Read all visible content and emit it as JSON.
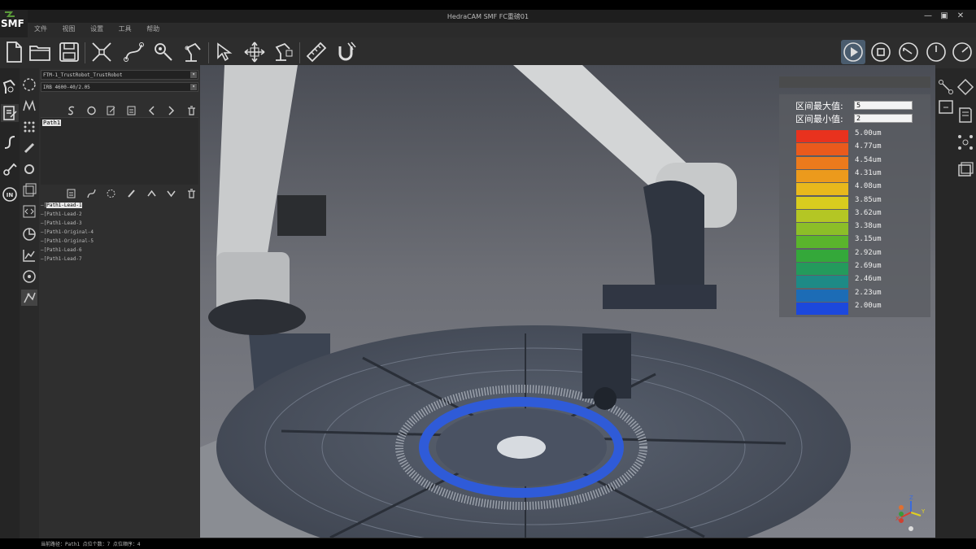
{
  "app": {
    "logo": "SMF",
    "title": "HedraCAM SMF FC重磅01",
    "window_controls": [
      "—",
      "▣",
      "✕"
    ]
  },
  "menu": [
    "文件",
    "视图",
    "设置",
    "工具",
    "帮助"
  ],
  "panel": {
    "robot_select": "FTM-1_TrustRobot_TrustRobot",
    "tool_select": "IRB 4600-40/2.05",
    "path_list": [
      "Path1"
    ],
    "tree_items": [
      {
        "label": "Path1-Lead-1",
        "selected": true
      },
      {
        "label": "Path1-Lead-2",
        "selected": false
      },
      {
        "label": "Path1-Lead-3",
        "selected": false
      },
      {
        "label": "Path1-Original-4",
        "selected": false
      },
      {
        "label": "Path1-Original-5",
        "selected": false
      },
      {
        "label": "Path1-Lead-6",
        "selected": false
      },
      {
        "label": "Path1-Lead-7",
        "selected": false
      }
    ]
  },
  "status": {
    "current_path": "当前路径：Path1  点位个数：7  点位顺序：4"
  },
  "legend": {
    "max_label": "区间最大值:",
    "max_value": "5",
    "min_label": "区间最小值:",
    "min_value": "2",
    "bands": [
      {
        "label": "5.00um",
        "color": "#e8321e"
      },
      {
        "label": "4.77um",
        "color": "#ea5a1c"
      },
      {
        "label": "4.54um",
        "color": "#ec7a1c"
      },
      {
        "label": "4.31um",
        "color": "#ec9a1c"
      },
      {
        "label": "4.08um",
        "color": "#e8b81c"
      },
      {
        "label": "3.85um",
        "color": "#d8cc1e"
      },
      {
        "label": "3.62um",
        "color": "#b4c624"
      },
      {
        "label": "3.38um",
        "color": "#8cbe28"
      },
      {
        "label": "3.15um",
        "color": "#5ab42c"
      },
      {
        "label": "2.92um",
        "color": "#34a83a"
      },
      {
        "label": "2.69um",
        "color": "#249a5c"
      },
      {
        "label": "2.46um",
        "color": "#1e8a86"
      },
      {
        "label": "2.23um",
        "color": "#1c6cb6"
      },
      {
        "label": "2.00um",
        "color": "#1c48dc"
      }
    ]
  },
  "axis": {
    "x": "X",
    "y": "Y",
    "z": "Z"
  }
}
